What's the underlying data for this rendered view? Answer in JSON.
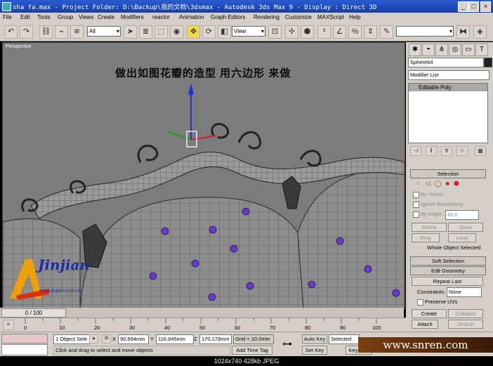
{
  "window": {
    "title": "sha fa.max    - Project Folder: D:\\Backup\\我的文档\\3dsmax   - Autodesk 3ds Max 9      - Display : Direct 3D"
  },
  "menu": [
    "File",
    "Edit",
    "Tools",
    "Group",
    "Views",
    "Create",
    "Modifiers",
    "reactor",
    "Animation",
    "Graph Editors",
    "Rendering",
    "Customize",
    "MAXScript",
    "Help"
  ],
  "toolbar": {
    "selection_filter": "All",
    "coord_system": "View"
  },
  "viewport": {
    "label": "Perspective",
    "caption": "做出如图花瓣的造型 用六边形 来做"
  },
  "logo": {
    "text": "Jinjian",
    "subtext": "www.jinjian-com.cn"
  },
  "panel": {
    "object_name": "Sphere64",
    "modifier_list": "Modifier List",
    "stack_item": "Editable Poly",
    "selection": {
      "title": "Selection",
      "by_vertex": "By Vertex",
      "ignore_backfacing": "Ignore Backfacing",
      "by_angle": "By Angle:",
      "angle_value": "45.0",
      "shrink": "Shrink",
      "grow": "Grow",
      "ring": "Ring",
      "loop": "Loop",
      "status": "Whole Object Selected"
    },
    "soft_selection": "Soft Selection",
    "edit_geometry": {
      "title": "Edit Geometry",
      "repeat_last": "Repeat Last",
      "constraints_label": "Constraints:",
      "constraints_value": "None",
      "preserve_uvs": "Preserve UVs",
      "create": "Create",
      "collapse": "Collapse",
      "attach": "Attach",
      "detach": "Detach"
    }
  },
  "timeline": {
    "frame": "0 / 100"
  },
  "ruler": {
    "ticks": [
      "0",
      "10",
      "20",
      "30",
      "40",
      "50",
      "60",
      "70",
      "80",
      "90",
      "100"
    ]
  },
  "status": {
    "selection": "1 Object Sele",
    "x_label": "X",
    "x": "90.994mm",
    "y_label": "Y",
    "y": "116.945mm",
    "z_label": "Z",
    "z": "170.179mm",
    "grid": "Grid = 10.0mm",
    "prompt": "Click and drag to select and move objects",
    "add_time_tag": "Add Time Tag",
    "auto_key": "Auto Key",
    "set_key": "Set Key",
    "key_mode": "Selected",
    "key_filters": "Key Filte"
  },
  "watermark": "www.snren.com",
  "footer": "1024x740  428kb  JPEG",
  "colors": {
    "title_bar": "#1f4fc0",
    "viewport_bg": "#7c7c7c",
    "chrome": "#d4d0c8",
    "vertex_purple": "#6a36d8"
  }
}
